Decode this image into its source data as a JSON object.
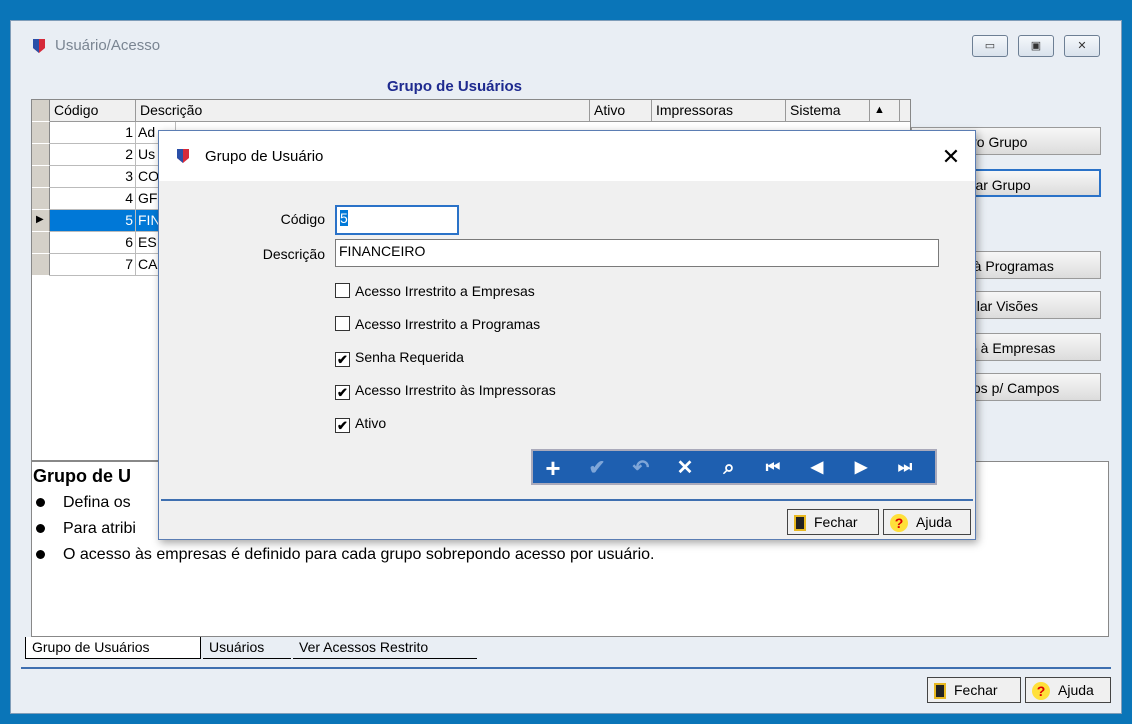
{
  "main_window": {
    "title": "Usuário/Acesso",
    "caption_buttons": {
      "minimize": "▭",
      "maximize": "▣",
      "close": "✕"
    },
    "header": "Grupo de Usuários",
    "columns": [
      "Código",
      "Descrição",
      "Ativo",
      "Impressoras",
      "Sistema"
    ],
    "rows": [
      {
        "code": "1",
        "desc": "Ad"
      },
      {
        "code": "2",
        "desc": "Us"
      },
      {
        "code": "3",
        "desc": "CO"
      },
      {
        "code": "4",
        "desc": "GF"
      },
      {
        "code": "5",
        "desc": "FIN"
      },
      {
        "code": "6",
        "desc": "ES"
      },
      {
        "code": "7",
        "desc": "CA"
      }
    ],
    "selected_row": 4,
    "side_buttons": [
      "ovo Grupo",
      "erar Grupo",
      "o à Programas",
      "cular Visões",
      "so à Empresas",
      "gios p/ Campos"
    ],
    "help": {
      "title": "Grupo de U",
      "bullets": [
        "Defina os",
        "Para atribi",
        "O acesso às empresas é definido para cada grupo sobrepondo acesso por usuário."
      ]
    },
    "tabs": [
      "Grupo de Usuários",
      "Usuários",
      "Ver Acessos Restrito"
    ],
    "fechar": "Fechar",
    "ajuda": "Ajuda"
  },
  "dialog": {
    "title": "Grupo de Usuário",
    "close": "✕",
    "codigo_label": "Código",
    "codigo_value": "5",
    "descricao_label": "Descrição",
    "descricao_value": "FINANCEIRO",
    "checkboxes": [
      {
        "label": "Acesso Irrestrito a Empresas",
        "checked": false
      },
      {
        "label": "Acesso Irrestrito a Programas",
        "checked": false
      },
      {
        "label": "Senha Requerida",
        "checked": true
      },
      {
        "label": "Acesso Irrestrito às Impressoras",
        "checked": true
      },
      {
        "label": "Ativo",
        "checked": true
      }
    ],
    "nav_buttons": [
      {
        "icon": "add-icon",
        "glyph": "+"
      },
      {
        "icon": "confirm-icon",
        "glyph": "✔"
      },
      {
        "icon": "undo-icon",
        "glyph": "↶"
      },
      {
        "icon": "delete-icon",
        "glyph": "✕"
      },
      {
        "icon": "search-icon",
        "glyph": "⌕"
      },
      {
        "icon": "first-icon",
        "glyph": "⏮"
      },
      {
        "icon": "prev-icon",
        "glyph": "◀"
      },
      {
        "icon": "next-icon",
        "glyph": "▶"
      },
      {
        "icon": "last-icon",
        "glyph": "⏭"
      }
    ],
    "fechar": "Fechar",
    "ajuda": "Ajuda"
  },
  "colors": {
    "accent": "#0078d7",
    "nav_bar": "#1e5fb0",
    "header_text": "#1e2a8f"
  }
}
